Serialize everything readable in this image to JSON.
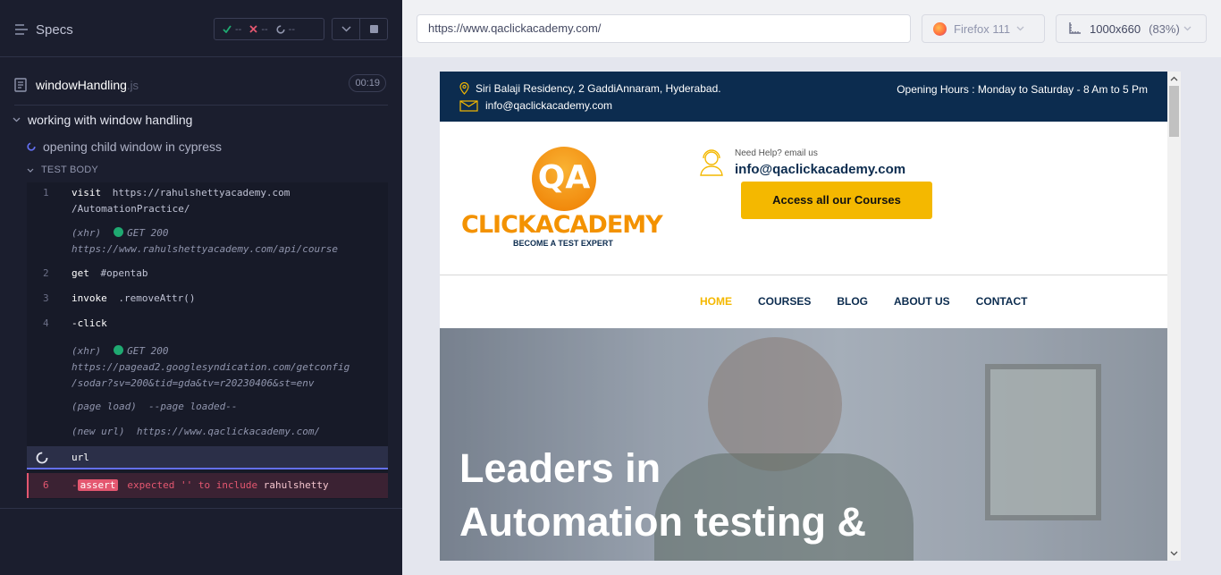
{
  "reporter": {
    "header": {
      "specs_label": "Specs",
      "passed": "--",
      "failed": "--",
      "pending": "--"
    },
    "spec_file": {
      "name": "windowHandling",
      "ext": ".js",
      "duration": "00:19"
    },
    "suite_title": "working with window handling",
    "test_title": "opening child window in cypress",
    "test_body_label": "TEST BODY",
    "commands": [
      {
        "num": "1",
        "name": "visit",
        "message": "https://rahulshettyacademy.com",
        "message2": "/AutomationPractice/"
      },
      {
        "event": "(xhr)",
        "status": "GET 200",
        "url": "https://www.rahulshettyacademy.com/api/course"
      },
      {
        "num": "2",
        "name": "get",
        "message": "#opentab"
      },
      {
        "num": "3",
        "name": "invoke",
        "message": ".removeAttr()"
      },
      {
        "num": "4",
        "name": "-click"
      },
      {
        "event": "(xhr)",
        "status": "GET 200",
        "url": "https://pagead2.googlesyndication.com/getconfig",
        "url2": "/sodar?sv=200&tid=gda&tv=r20230406&st=env"
      },
      {
        "event": "(page load)",
        "message": "--page loaded--"
      },
      {
        "event": "(new url)",
        "message": "https://www.qaclickacademy.com/"
      },
      {
        "name": "url"
      },
      {
        "num": "6",
        "prefix": "-",
        "badge": "assert",
        "parts": [
          "expected",
          "''",
          "to include",
          "rahulshetty"
        ]
      }
    ]
  },
  "aut": {
    "url": "https://www.qaclickacademy.com/",
    "browser": "Firefox 111",
    "viewport": "1000x660",
    "scale": "(83%)"
  },
  "site": {
    "address": "Siri Balaji Residency, 2 GaddiAnnaram, Hyderabad.",
    "email_top": "info@qaclickacademy.com",
    "hours": "Opening Hours : Monday to Saturday - 8 Am to 5 Pm",
    "logo_qa": "QA",
    "logo_name": "CLICKACADEMY",
    "logo_tagline": "BECOME A TEST EXPERT",
    "help_small": "Need Help? email us",
    "help_email": "info@qaclickacademy.com",
    "cta": "Access all our Courses",
    "nav": [
      "HOME",
      "COURSES",
      "BLOG",
      "ABOUT US",
      "CONTACT"
    ],
    "hero_line1": "Leaders in",
    "hero_line2": "Automation testing &"
  },
  "colors": {
    "reporter_bg": "#1b1e2e",
    "pass": "#1fa971",
    "fail": "#e45770",
    "accent": "#6470f3",
    "site_navy": "#0c2c4f",
    "site_yellow": "#f4b800"
  }
}
